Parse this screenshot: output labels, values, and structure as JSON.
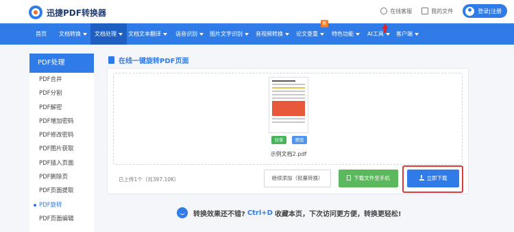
{
  "header": {
    "logo_text": "迅捷PDF转换器",
    "support_label": "在线客服",
    "my_files_label": "我的文件",
    "login_label": "登录|注册"
  },
  "nav": {
    "items": [
      {
        "label": "首页"
      },
      {
        "label": "文档转换"
      },
      {
        "label": "文档处理"
      },
      {
        "label": "文档文本翻译"
      },
      {
        "label": "语音识别"
      },
      {
        "label": "图片文字识别"
      },
      {
        "label": "音视频转换"
      },
      {
        "label": "论文查重"
      },
      {
        "label": "特色功能"
      },
      {
        "label": "AI工具"
      },
      {
        "label": "客户端"
      }
    ],
    "badge": "新"
  },
  "sidebar": {
    "header": "PDF处理",
    "items": [
      {
        "label": "PDF合并"
      },
      {
        "label": "PDF分割"
      },
      {
        "label": "PDF解密"
      },
      {
        "label": "PDF增加密码"
      },
      {
        "label": "PDF修改密码"
      },
      {
        "label": "PDF图片获取"
      },
      {
        "label": "PDF插入页面"
      },
      {
        "label": "PDF删除页"
      },
      {
        "label": "PDF页面提取"
      },
      {
        "label": "PDF旋转"
      },
      {
        "label": "PDF页面编辑"
      }
    ]
  },
  "main": {
    "title": "在线一键旋转PDF页面",
    "file": {
      "name": "示例文档2.pdf",
      "share_label": "分享",
      "preview_label": "预览"
    },
    "upload_info": "已上传1个（共397.10K）",
    "continue_label": "继续添加（批量转换）",
    "phone_label": "下载文件至手机",
    "download_label": "立即下载"
  },
  "tip": {
    "before": "转换效果还不错?",
    "shortcut": "Ctrl+D",
    "after": "收藏本页，下次访问更方便，转换更轻松!"
  },
  "colors": {
    "brand_blue": "#2f7be8",
    "nav_active": "#1f5fc1",
    "green": "#5cb85c",
    "highlight_red": "#e0393a"
  }
}
